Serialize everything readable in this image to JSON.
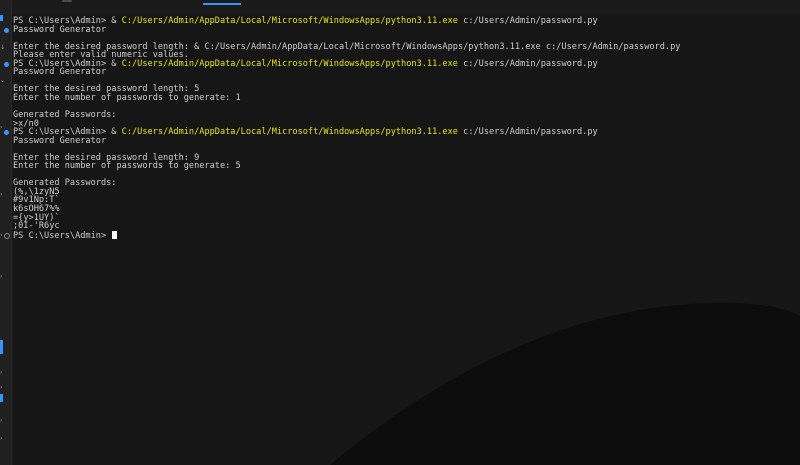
{
  "terminal": {
    "lines": [
      {
        "segments": [
          {
            "t": "PS C:\\Users\\Admin> & ",
            "c": "prompt"
          },
          {
            "t": "C:/Users/Admin/AppData/Local/Microsoft/WindowsApps/python3.11.exe",
            "c": "path"
          },
          {
            "t": " c:/Users/Admin/password.py",
            "c": "arg"
          }
        ]
      },
      {
        "segments": [
          {
            "t": "Password Generator",
            "c": "arg"
          }
        ],
        "marker": "blue"
      },
      {
        "segments": [
          {
            "t": "",
            "c": "arg"
          }
        ]
      },
      {
        "segments": [
          {
            "t": "Enter the desired password length: & C:/Users/Admin/AppData/Local/Microsoft/WindowsApps/python3.11.exe c:/Users/Admin/password.py",
            "c": "arg"
          }
        ]
      },
      {
        "segments": [
          {
            "t": "Please enter valid numeric values.",
            "c": "arg"
          }
        ]
      },
      {
        "segments": [
          {
            "t": "PS C:\\Users\\Admin> & ",
            "c": "prompt"
          },
          {
            "t": "C:/Users/Admin/AppData/Local/Microsoft/WindowsApps/python3.11.exe",
            "c": "path"
          },
          {
            "t": " c:/Users/Admin/password.py",
            "c": "arg"
          }
        ],
        "marker": "blue"
      },
      {
        "segments": [
          {
            "t": "Password Generator",
            "c": "arg"
          }
        ]
      },
      {
        "segments": [
          {
            "t": "",
            "c": "arg"
          }
        ]
      },
      {
        "segments": [
          {
            "t": "Enter the desired password length: 5",
            "c": "arg"
          }
        ]
      },
      {
        "segments": [
          {
            "t": "Enter the number of passwords to generate: 1",
            "c": "arg"
          }
        ]
      },
      {
        "segments": [
          {
            "t": "",
            "c": "arg"
          }
        ]
      },
      {
        "segments": [
          {
            "t": "Generated Passwords:",
            "c": "arg"
          }
        ]
      },
      {
        "segments": [
          {
            "t": ">x/n0",
            "c": "arg"
          }
        ]
      },
      {
        "segments": [
          {
            "t": "PS C:\\Users\\Admin> & ",
            "c": "prompt"
          },
          {
            "t": "C:/Users/Admin/AppData/Local/Microsoft/WindowsApps/python3.11.exe",
            "c": "path"
          },
          {
            "t": " c:/Users/Admin/password.py",
            "c": "arg"
          }
        ],
        "marker": "blue"
      },
      {
        "segments": [
          {
            "t": "Password Generator",
            "c": "arg"
          }
        ]
      },
      {
        "segments": [
          {
            "t": "",
            "c": "arg"
          }
        ]
      },
      {
        "segments": [
          {
            "t": "Enter the desired password length: 9",
            "c": "arg"
          }
        ]
      },
      {
        "segments": [
          {
            "t": "Enter the number of passwords to generate: 5",
            "c": "arg"
          }
        ]
      },
      {
        "segments": [
          {
            "t": "",
            "c": "arg"
          }
        ]
      },
      {
        "segments": [
          {
            "t": "Generated Passwords:",
            "c": "arg"
          }
        ]
      },
      {
        "segments": [
          {
            "t": "(%,\\1zyN5",
            "c": "arg"
          }
        ]
      },
      {
        "segments": [
          {
            "t": "#9v1Np:T`",
            "c": "arg"
          }
        ]
      },
      {
        "segments": [
          {
            "t": "k6sOH67%%",
            "c": "arg"
          }
        ]
      },
      {
        "segments": [
          {
            "t": "={y>1UY)`",
            "c": "arg"
          }
        ]
      },
      {
        "segments": [
          {
            "t": ";0I-'R6yc",
            "c": "arg"
          }
        ]
      },
      {
        "segments": [
          {
            "t": "PS C:\\Users\\Admin> ",
            "c": "prompt"
          }
        ],
        "marker": "hollow",
        "cursor": true
      }
    ]
  },
  "colors": {
    "background": "#161616",
    "text": "#cccccc",
    "path": "#e5e510",
    "accent": "#3794ff"
  }
}
